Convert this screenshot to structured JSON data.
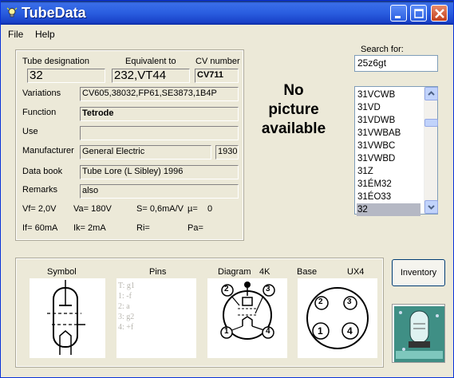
{
  "window": {
    "title": "TubeData"
  },
  "menu": {
    "file": "File",
    "help": "Help"
  },
  "labels": {
    "tube_designation": "Tube designation",
    "equivalent_to": "Equivalent to",
    "cv_number": "CV number",
    "variations": "Variations",
    "function": "Function",
    "use": "Use",
    "manufacturer": "Manufacturer",
    "data_book": "Data book",
    "remarks": "Remarks"
  },
  "values": {
    "tube_designation": "32",
    "equivalent_to": "232,VT44",
    "cv_number": "CV711",
    "variations": "CV605,38032,FP61,SE3873,1B4P",
    "function": "Tetrode",
    "use": "",
    "manufacturer": "General Electric",
    "year": "1930",
    "data_book": "Tube Lore (L Sibley) 1996",
    "remarks": "also"
  },
  "params": {
    "vf": "Vf= 2,0V",
    "va": "Va= 180V",
    "s": "S= 0,6mA/V",
    "mu": "µ=",
    "mu_val": "0",
    "if": "If= 60mA",
    "ik": "Ik= 2mA",
    "ri": "Ri=",
    "pa": "Pa="
  },
  "picture": {
    "line1": "No",
    "line2": "picture",
    "line3": "available"
  },
  "search": {
    "label": "Search for:",
    "value": "25z6gt"
  },
  "tube_list": {
    "items": [
      "31VCWB",
      "31VD",
      "31VDWB",
      "31VWBAB",
      "31VWBC",
      "31VWBD",
      "31Z",
      "31ÉM32",
      "31ÉO33",
      "32"
    ],
    "selected_index": 9
  },
  "bottom": {
    "symbol": "Symbol",
    "pins": "Pins",
    "diagram": "Diagram",
    "diagram_code": "4K",
    "base": "Base",
    "base_code": "UX4",
    "pin_list": [
      "T: g1",
      "1: -f",
      "2: a",
      "3: g2",
      "4: +f"
    ],
    "diagram_pins": [
      "2",
      "3",
      "1",
      "4"
    ],
    "base_pins": [
      "2",
      "3",
      "1",
      "4"
    ]
  },
  "buttons": {
    "inventory": "Inventory"
  },
  "icons": [
    "lightbulb-icon",
    "minimize-icon",
    "maximize-icon",
    "close-icon",
    "scroll-up-icon",
    "scroll-down-icon",
    "tube-logo-icon",
    "tube-symbol-icon"
  ]
}
